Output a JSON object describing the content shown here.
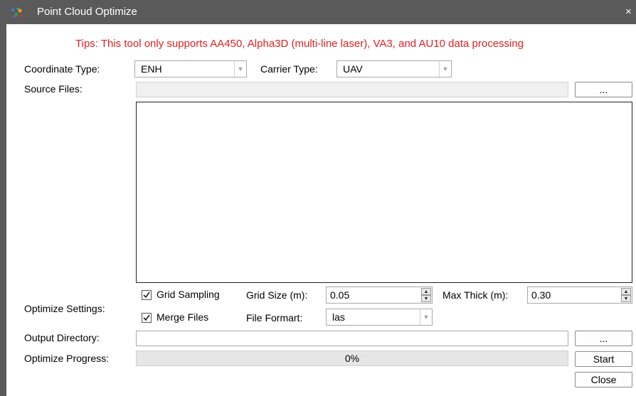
{
  "window": {
    "title": "Point Cloud Optimize",
    "close_glyph": "×",
    "icon": "point-cloud-app-icon"
  },
  "tips": "Tips: This tool only supports AA450, Alpha3D (multi-line laser), VA3, and AU10 data processing",
  "coordinate": {
    "label": "Coordinate Type:",
    "value": "ENH"
  },
  "carrier": {
    "label": "Carrier Type:",
    "value": "UAV"
  },
  "source": {
    "label": "Source Files:",
    "path": "",
    "browse_label": "...",
    "files": []
  },
  "settings": {
    "label": "Optimize Settings:",
    "grid_sampling": {
      "label": "Grid Sampling",
      "checked": true
    },
    "grid_size": {
      "label": "Grid Size (m):",
      "value": "0.05"
    },
    "max_thick": {
      "label": "Max Thick (m):",
      "value": "0.30"
    },
    "merge_files": {
      "label": "Merge Files",
      "checked": true
    },
    "file_format": {
      "label": "File Formart:",
      "value": "las"
    }
  },
  "output": {
    "label": "Output Directory:",
    "path": "",
    "browse_label": "..."
  },
  "progress": {
    "label": "Optimize Progress:",
    "value": 0,
    "text": "0%"
  },
  "buttons": {
    "start": "Start",
    "close": "Close"
  },
  "colors": {
    "tips": "#e02020",
    "titlebar": "#5a5a5a"
  }
}
